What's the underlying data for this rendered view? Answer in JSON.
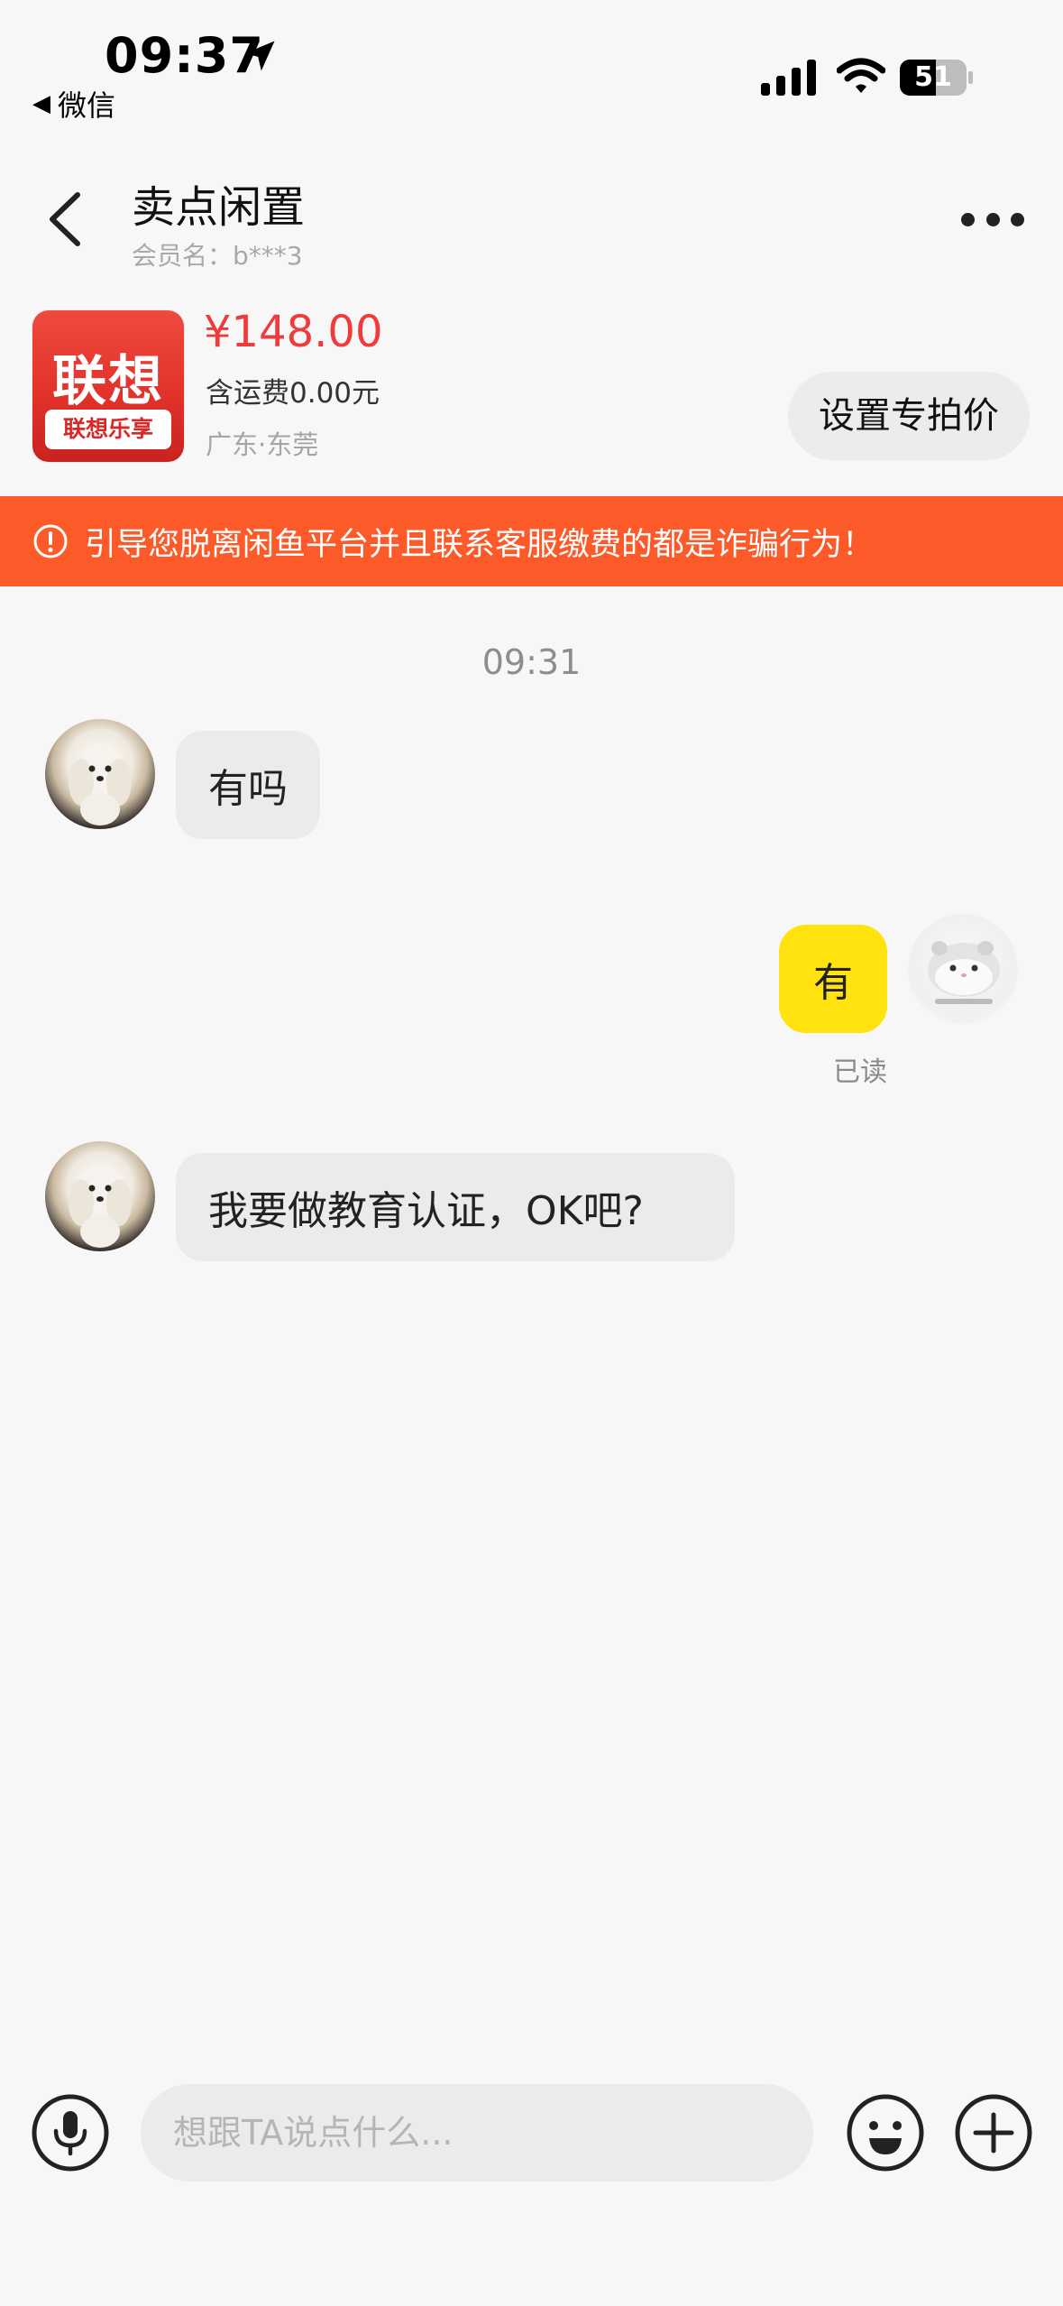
{
  "status_bar": {
    "time": "09:37",
    "back_app": "微信",
    "battery": "51"
  },
  "header": {
    "title": "卖点闲置",
    "member": "会员名：b***3"
  },
  "product": {
    "image_brand": "联想",
    "image_tag": "联想乐享",
    "price": "¥148.00",
    "shipping": "含运费0.00元",
    "location": "广东·东莞",
    "set_price_button": "设置专拍价"
  },
  "warning": {
    "text": "引导您脱离闲鱼平台并且联系客服缴费的都是诈骗行为！"
  },
  "chat": {
    "timestamp": "09:31",
    "messages": [
      {
        "from": "other",
        "text": "有吗"
      },
      {
        "from": "me",
        "text": "有",
        "status": "已读"
      },
      {
        "from": "other",
        "text": "我要做教育认证，OK吧?"
      }
    ]
  },
  "composer": {
    "placeholder": "想跟TA说点什么..."
  },
  "colors": {
    "accent_yellow": "#ffe20e",
    "warning_orange": "#fd5a2a",
    "price_red": "#ef3b3b"
  }
}
